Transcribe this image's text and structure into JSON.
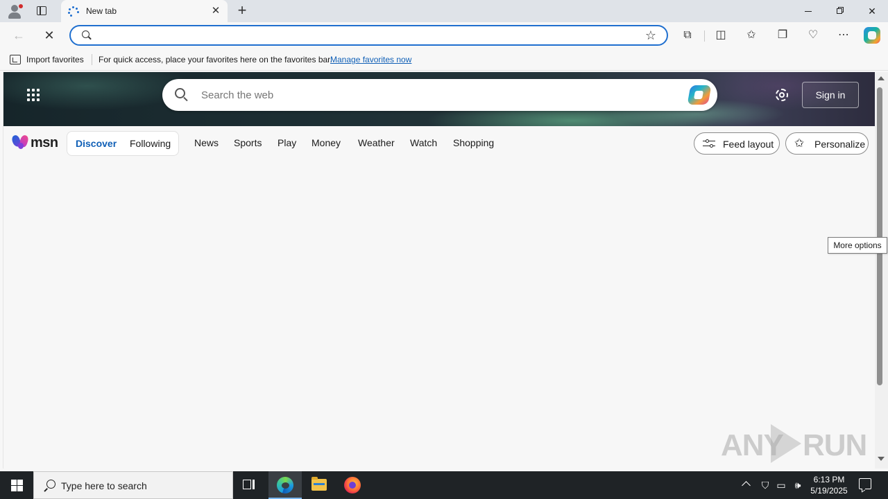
{
  "browser": {
    "tab": {
      "title": "New tab",
      "close_glyph": "✕",
      "loading_icon": "loading-spinner-icon"
    },
    "new_tab_glyph": "+",
    "window_controls": {
      "close_glyph": "✕"
    },
    "address_bar": {
      "value": "",
      "placeholder": ""
    },
    "toolbar_glyphs": {
      "back": "←",
      "stop": "✕",
      "favorite": "☆",
      "extensions": "⧉",
      "split_screen": "◫",
      "favorites": "✩",
      "collections": "❐",
      "browser_essentials": "♡",
      "more": "⋯"
    }
  },
  "favorites_bar": {
    "import_label": "Import favorites",
    "message": "For quick access, place your favorites here on the favorites bar.",
    "link_label": "Manage favorites now"
  },
  "msn": {
    "logo_text": "msn",
    "search": {
      "placeholder": "Search the web",
      "value": ""
    },
    "sign_in_label": "Sign in",
    "feed_tabs": [
      {
        "label": "Discover",
        "active": true
      },
      {
        "label": "Following",
        "active": false
      }
    ],
    "nav_links": [
      "News",
      "Sports",
      "Play",
      "Money",
      "Weather",
      "Watch",
      "Shopping"
    ],
    "feed_layout_label": "Feed layout",
    "personalize_label": "Personalize",
    "personalize_glyph": "✩"
  },
  "tooltip": {
    "text": "More options"
  },
  "watermark": {
    "left": "ANY",
    "right": "RUN"
  },
  "taskbar": {
    "search_placeholder": "Type here to search",
    "time": "6:13 PM",
    "date": "5/19/2025",
    "tray_glyphs": {
      "security": "⛉",
      "network": "▭",
      "volume": "🕪"
    }
  },
  "colors": {
    "accent": "#1f6fcf",
    "link": "#0f5fb6",
    "taskbar": "#1f2326"
  }
}
